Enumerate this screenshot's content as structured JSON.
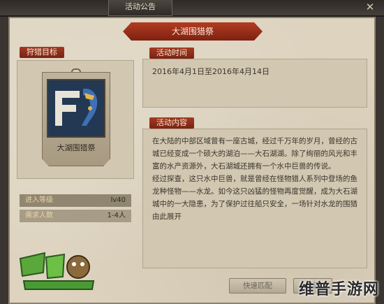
{
  "window": {
    "tab_title": "活动公告",
    "close_glyph": "✕"
  },
  "event": {
    "title": "大湖围猎祭"
  },
  "target_section": {
    "header": "狩猎目标",
    "monster_name": "大湖围猎祭"
  },
  "requirements": [
    {
      "label": "进入等级",
      "value": "lv40"
    },
    {
      "label": "需求人数",
      "value": "1-4人"
    }
  ],
  "time_section": {
    "header": "活动时间",
    "text": "2016年4月1日至2016年4月14日"
  },
  "content_section": {
    "header": "活动内容",
    "paragraph1": "在大陆的中部区域曾有一座古城，经过千万年的岁月，曾经的古城已经变成一个硕大的湖泊——大石湖湖。除了绚丽的风光和丰富的水产资源外，大石湖城还拥有一个水中巨兽的传说。",
    "paragraph2": "经过探查，这只水中巨兽，就是曾经在怪物猎人系列中登场的鱼龙种怪物——水龙。如今这只凶猛的怪物再度觉醒，成为大石湖城中的一大隐患，为了保护过往船只安全，一场针对水龙的围猎由此展开"
  },
  "buttons": {
    "quick_match": "快速匹配",
    "create": "创建"
  },
  "watermark": {
    "text": "维普手游网"
  },
  "colors": {
    "banner_red": "#a33a22",
    "parchment": "#ddd3bf",
    "emblem_blue": "#233852"
  }
}
